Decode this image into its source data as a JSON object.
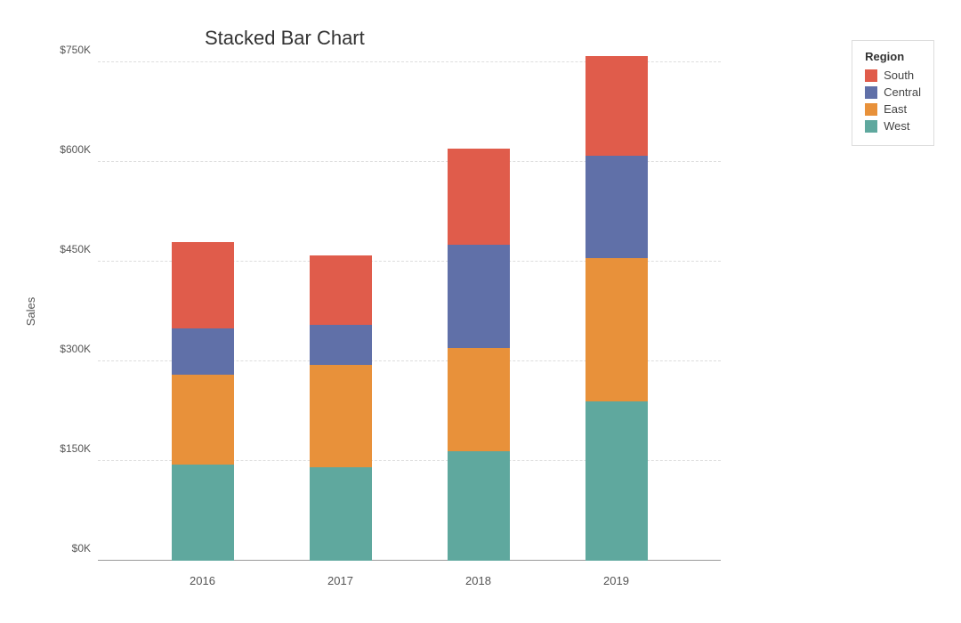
{
  "title": "Stacked Bar Chart",
  "yAxisLabel": "Sales",
  "colors": {
    "south": "#e05c4b",
    "central": "#6070a8",
    "east": "#e8913a",
    "west": "#5fa89e"
  },
  "legend": {
    "title": "Region",
    "items": [
      {
        "label": "South",
        "colorKey": "south"
      },
      {
        "label": "Central",
        "colorKey": "central"
      },
      {
        "label": "East",
        "colorKey": "east"
      },
      {
        "label": "West",
        "colorKey": "west"
      }
    ]
  },
  "yAxis": {
    "ticks": [
      {
        "label": "$0K",
        "value": 0
      },
      {
        "label": "$150K",
        "value": 150000
      },
      {
        "label": "$300K",
        "value": 300000
      },
      {
        "label": "$450K",
        "value": 450000
      },
      {
        "label": "$600K",
        "value": 600000
      },
      {
        "label": "$750K",
        "value": 750000
      }
    ],
    "max": 750000
  },
  "bars": [
    {
      "year": "2016",
      "west": 145000,
      "east": 135000,
      "central": 70000,
      "south": 130000
    },
    {
      "year": "2017",
      "west": 140000,
      "east": 155000,
      "central": 60000,
      "south": 105000
    },
    {
      "year": "2018",
      "west": 165000,
      "east": 155000,
      "central": 155000,
      "south": 145000
    },
    {
      "year": "2019",
      "west": 240000,
      "east": 215000,
      "central": 155000,
      "south": 150000
    }
  ]
}
